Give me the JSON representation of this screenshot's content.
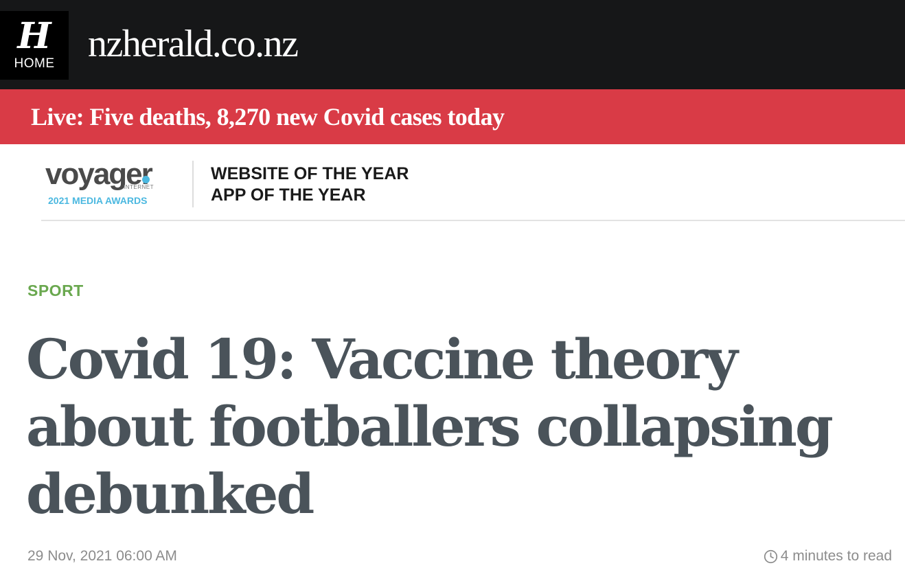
{
  "header": {
    "logo_glyph": "H",
    "home_label": "HOME",
    "site_name": "nzherald.co.nz",
    "background_color": "#161718"
  },
  "breaking_news": {
    "text": "Live: Five deaths, 8,270 new Covid cases today",
    "background_color": "#d93b46"
  },
  "awards_banner": {
    "logo_word": "voyager",
    "logo_subtext": "INTERNET",
    "logo_year_text": "2021 MEDIA AWARDS",
    "lines": [
      "WEBSITE OF THE YEAR",
      "APP OF THE YEAR"
    ]
  },
  "article": {
    "category": "SPORT",
    "category_color": "#6aa84f",
    "headline": "Covid 19: Vaccine theory about footballers collapsing debunked",
    "date": "29 Nov, 2021 06:00 AM",
    "read_time": "4 minutes to read",
    "read_time_icon": "clock-icon"
  }
}
